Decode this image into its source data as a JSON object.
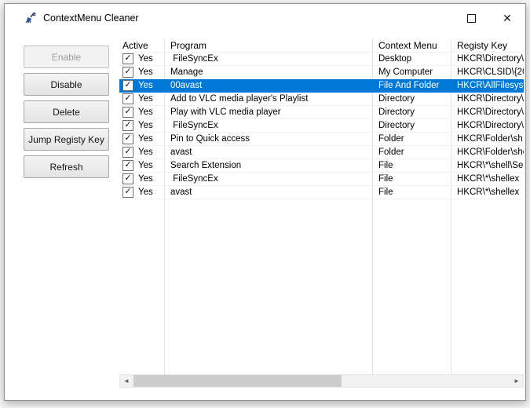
{
  "window": {
    "title": "ContextMenu Cleaner",
    "controls": {
      "close": "✕"
    }
  },
  "sidebar": {
    "buttons": [
      {
        "label": "Enable",
        "enabled": false
      },
      {
        "label": "Disable",
        "enabled": true
      },
      {
        "label": "Delete",
        "enabled": true
      },
      {
        "label": "Jump Registy Key",
        "enabled": true
      },
      {
        "label": "Refresh",
        "enabled": true
      }
    ]
  },
  "table": {
    "columns": [
      "Active",
      "Program",
      "Context Menu",
      "Registy Key"
    ],
    "rows": [
      {
        "active": "Yes",
        "program": " FileSyncEx",
        "context_menu": "Desktop",
        "registry_key": "HKCR\\Directory\\",
        "selected": false
      },
      {
        "active": "Yes",
        "program": "Manage",
        "context_menu": "My Computer",
        "registry_key": "HKCR\\CLSID\\{20",
        "selected": false
      },
      {
        "active": "Yes",
        "program": "00avast",
        "context_menu": "File And Folder",
        "registry_key": "HKCR\\AllFilesyst",
        "selected": true
      },
      {
        "active": "Yes",
        "program": "Add to VLC media player's Playlist",
        "context_menu": "Directory",
        "registry_key": "HKCR\\Directory\\",
        "selected": false
      },
      {
        "active": "Yes",
        "program": "Play with VLC media player",
        "context_menu": "Directory",
        "registry_key": "HKCR\\Directory\\",
        "selected": false
      },
      {
        "active": "Yes",
        "program": " FileSyncEx",
        "context_menu": "Directory",
        "registry_key": "HKCR\\Directory\\",
        "selected": false
      },
      {
        "active": "Yes",
        "program": "Pin to Quick access",
        "context_menu": "Folder",
        "registry_key": "HKCR\\Folder\\sh",
        "selected": false
      },
      {
        "active": "Yes",
        "program": "avast",
        "context_menu": "Folder",
        "registry_key": "HKCR\\Folder\\she",
        "selected": false
      },
      {
        "active": "Yes",
        "program": "Search Extension",
        "context_menu": "File",
        "registry_key": "HKCR\\*\\shell\\Se",
        "selected": false
      },
      {
        "active": "Yes",
        "program": " FileSyncEx",
        "context_menu": "File",
        "registry_key": "HKCR\\*\\shellex",
        "selected": false
      },
      {
        "active": "Yes",
        "program": "avast",
        "context_menu": "File",
        "registry_key": "HKCR\\*\\shellex",
        "selected": false
      }
    ]
  },
  "icons": {
    "check": "✓"
  },
  "scrollbar": {
    "left_arrow": "◄",
    "right_arrow": "►"
  },
  "colors": {
    "selection": "#0078d7",
    "grid_line": "#e2e2e2",
    "button_border": "#a6a6a6"
  }
}
